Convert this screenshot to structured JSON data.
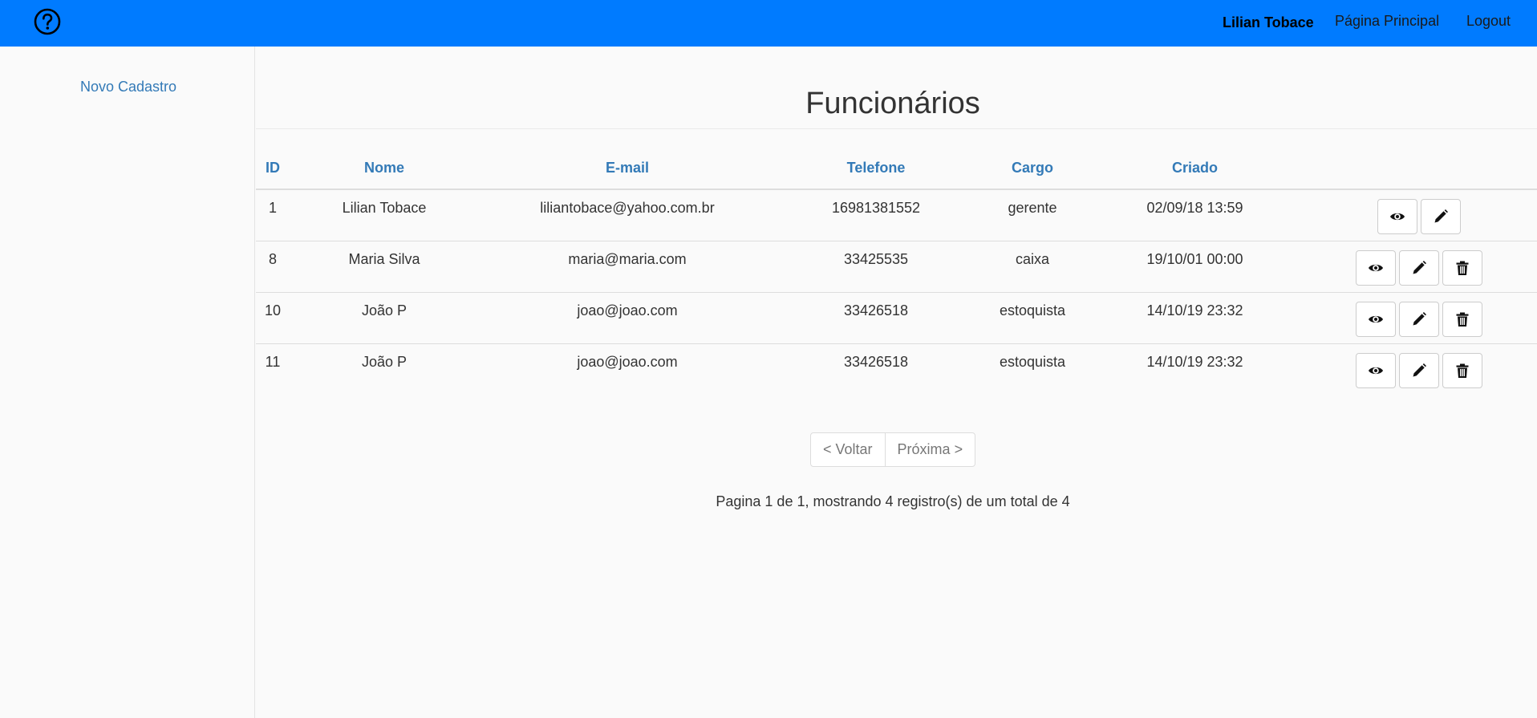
{
  "navbar": {
    "help_icon": "question-circle-icon",
    "user_name": "Lilian Tobace",
    "home_label": "Página Principal",
    "logout_label": "Logout"
  },
  "sidebar": {
    "new_record_label": "Novo Cadastro"
  },
  "main": {
    "title": "Funcionários",
    "columns": [
      "ID",
      "Nome",
      "E-mail",
      "Telefone",
      "Cargo",
      "Criado"
    ],
    "rows": [
      {
        "id": "1",
        "nome": "Lilian Tobace",
        "email": "liliantobace@yahoo.com.br",
        "telefone": "16981381552",
        "cargo": "gerente",
        "criado": "02/09/18 13:59",
        "actions": [
          "view",
          "edit"
        ]
      },
      {
        "id": "8",
        "nome": "Maria Silva",
        "email": "maria@maria.com",
        "telefone": "33425535",
        "cargo": "caixa",
        "criado": "19/10/01 00:00",
        "actions": [
          "view",
          "edit",
          "delete"
        ]
      },
      {
        "id": "10",
        "nome": "João P",
        "email": "joao@joao.com",
        "telefone": "33426518",
        "cargo": "estoquista",
        "criado": "14/10/19 23:32",
        "actions": [
          "view",
          "edit",
          "delete"
        ]
      },
      {
        "id": "11",
        "nome": "João P",
        "email": "joao@joao.com",
        "telefone": "33426518",
        "cargo": "estoquista",
        "criado": "14/10/19 23:32",
        "actions": [
          "view",
          "edit",
          "delete"
        ]
      }
    ],
    "action_icons": {
      "view": "eye-icon",
      "edit": "pencil-icon",
      "delete": "trash-icon"
    },
    "pagination": {
      "prev_label": "< Voltar",
      "next_label": "Próxima >"
    },
    "summary": "Pagina 1 de 1, mostrando 4 registro(s) de um total de 4"
  },
  "colors": {
    "navbar": "#007bff",
    "link": "#337ab7",
    "background": "#fafafa"
  }
}
